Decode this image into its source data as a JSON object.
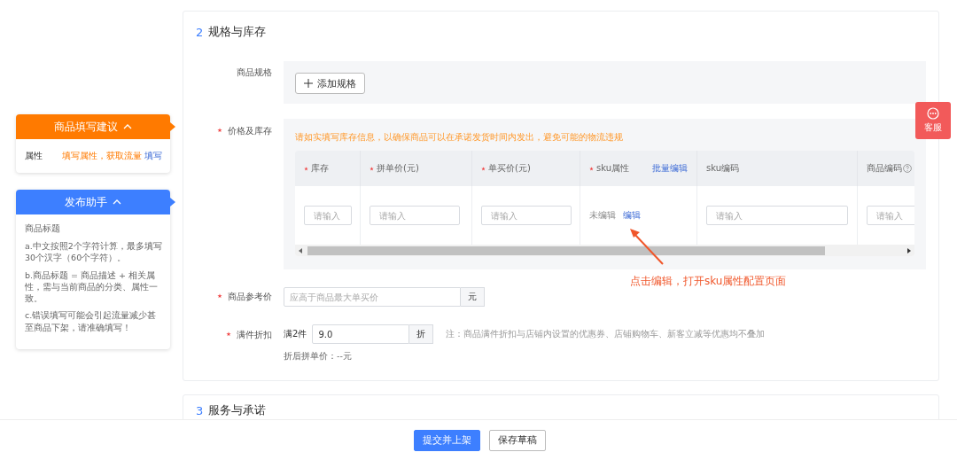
{
  "sidebar": {
    "suggestion_card": {
      "title": "商品填写建议",
      "expanded": true,
      "rows": [
        {
          "label": "属性",
          "hint": "填写属性，获取流量",
          "action": "填写"
        }
      ]
    },
    "helper_card": {
      "title": "发布助手",
      "expanded": true,
      "heading": "商品标题",
      "tips": [
        "a.中文按照2个字符计算，最多填写30个汉字（60个字符）。",
        "b.商品标题 = 商品描述 + 相关属性，需与当前商品的分类、属性一致。",
        "c.错误填写可能会引起流量减少甚至商品下架，请准确填写！"
      ]
    }
  },
  "section": {
    "number": "2",
    "title": "规格与库存"
  },
  "spec": {
    "label": "商品规格",
    "add_button": "添加规格"
  },
  "price_stock": {
    "label": "价格及库存",
    "required": true,
    "notice": "请如实填写库存信息，以确保商品可以在承诺发货时间内发出，避免可能的物流违规",
    "columns": [
      {
        "label": "库存",
        "required": true
      },
      {
        "label": "拼单价(元)",
        "required": true
      },
      {
        "label": "单买价(元)",
        "required": true
      },
      {
        "label": "sku属性",
        "required": true,
        "action": "批量编辑"
      },
      {
        "label": "sku编码",
        "required": false
      },
      {
        "label": "商品编码",
        "required": false,
        "help": true
      }
    ],
    "row": [
      {
        "kind": "input",
        "placeholder": "请输入"
      },
      {
        "kind": "input",
        "placeholder": "请输入"
      },
      {
        "kind": "input",
        "placeholder": "请输入"
      },
      {
        "kind": "status",
        "status": "未编辑",
        "action": "编辑"
      },
      {
        "kind": "input",
        "placeholder": "请输入"
      },
      {
        "kind": "input",
        "placeholder": "请输入"
      }
    ]
  },
  "annotation": "点击编辑，打开sku属性配置页面",
  "reference_price": {
    "label": "商品参考价",
    "required": true,
    "placeholder": "应高于商品最大单买价",
    "unit": "元"
  },
  "discount": {
    "label": "满件折扣",
    "required": true,
    "prefix": "满2件",
    "value": "9.0",
    "unit": "折",
    "note": "注：商品满件折扣与店铺内设置的优惠券、店铺购物车、新客立减等优惠均不叠加",
    "result": "折后拼单价：--元"
  },
  "next_section": {
    "number": "3",
    "title": "服务与承诺"
  },
  "customer_service": {
    "label": "客服"
  },
  "buttons": [
    {
      "label": "提交并上架",
      "primary": true
    },
    {
      "label": "保存草稿",
      "primary": false
    }
  ]
}
